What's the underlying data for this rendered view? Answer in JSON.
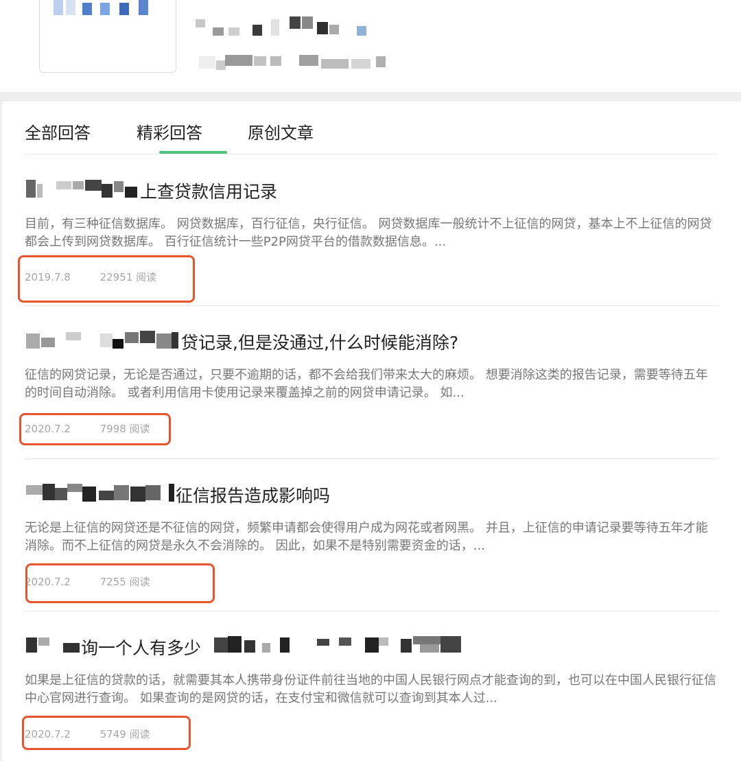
{
  "tabs": [
    {
      "label": "全部回答"
    },
    {
      "label": "精彩回答"
    },
    {
      "label": "原创文章"
    }
  ],
  "active_tab": "精彩回答",
  "accent_color": "#4fc27a",
  "highlight_color": "#e8542b",
  "articles": [
    {
      "title": "上查贷款信用记录",
      "excerpt": "目前，有三种征信数据库。 网贷数据库，百行征信，央行征信。 网贷数据库一般统计不上征信的网贷，基本上不上征信的网贷都会上传到网贷数据库。 百行征信统计一些P2P网贷平台的借款数据信息。...",
      "date": "2019.7.8",
      "reads": "22951 阅读"
    },
    {
      "title": "贷记录,但是没通过,什么时候能消除?",
      "excerpt": "征信的网贷记录，无论是否通过，只要不逾期的话，都不会给我们带来太大的麻烦。 想要消除这类的报告记录，需要等待五年的时间自动消除。 或者利用信用卡使用记录来覆盖掉之前的网贷申请记录。 如...",
      "date": "2020.7.2",
      "reads": "7998 阅读"
    },
    {
      "title": "征信报告造成影响吗",
      "excerpt": "无论是上征信的网贷还是不征信的网贷，频繁申请都会使得用户成为网花或者网黑。 并且，上征信的申请记录要等待五年才能消除。而不上征信的网贷是永久不会消除的。 因此，如果不是特别需要资金的话，...",
      "date": "2020.7.2",
      "reads": "7255 阅读"
    },
    {
      "title": "询一个人有多少",
      "excerpt": "如果是上征信的贷款的话，就需要其本人携带身份证件前往当地的中国人民银行网点才能查询的到，也可以在中国人民银行征信中心官网进行查询。 如果查询的是网贷的话，在支付宝和微信就可以查询到其本人过...",
      "date": "2020.7.2",
      "reads": "5749 阅读"
    }
  ]
}
